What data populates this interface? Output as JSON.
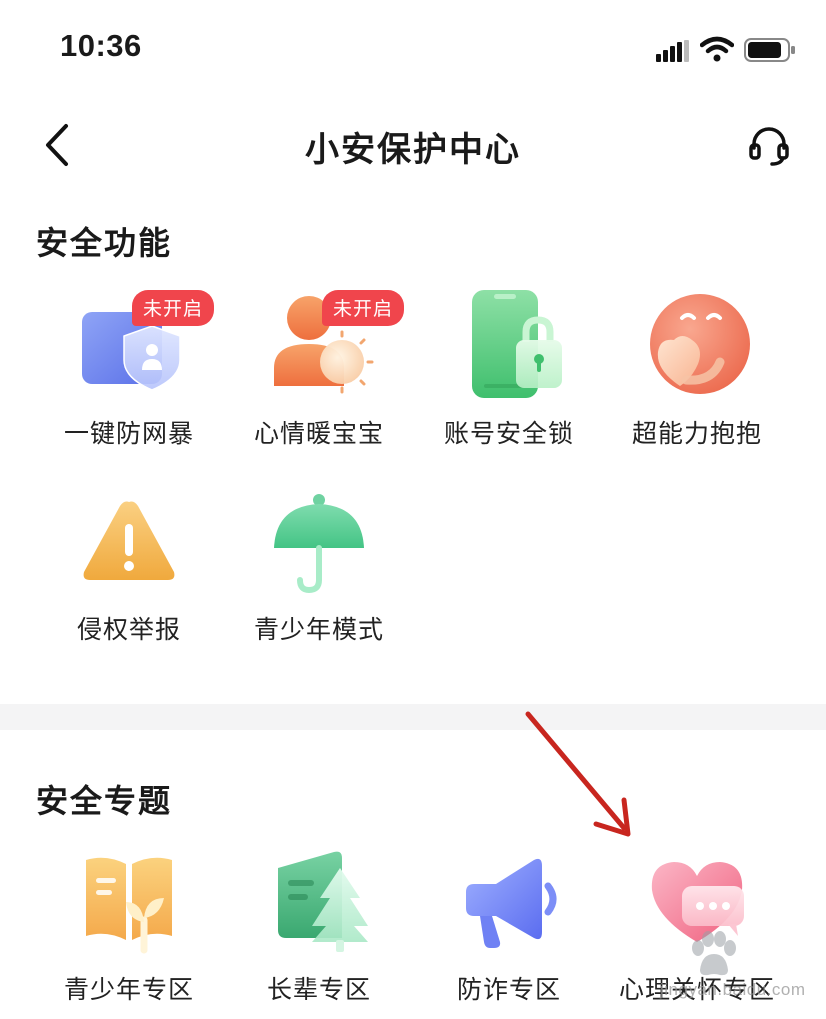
{
  "status_bar": {
    "time": "10:36",
    "icons": [
      "signal-icon",
      "wifi-icon",
      "battery-icon"
    ]
  },
  "nav": {
    "title": "小安保护中心",
    "back_icon": "chevron-left-icon",
    "service_icon": "headset-icon"
  },
  "safety_features": {
    "title": "安全功能",
    "items": [
      {
        "label": "一键防网暴",
        "icon": "shield-user-icon",
        "badge": "未开启"
      },
      {
        "label": "心情暖宝宝",
        "icon": "sun-person-icon",
        "badge": "未开启"
      },
      {
        "label": "账号安全锁",
        "icon": "phone-lock-icon",
        "badge": ""
      },
      {
        "label": "超能力抱抱",
        "icon": "hug-face-icon",
        "badge": ""
      },
      {
        "label": "侵权举报",
        "icon": "warning-icon",
        "badge": ""
      },
      {
        "label": "青少年模式",
        "icon": "umbrella-icon",
        "badge": ""
      }
    ]
  },
  "safety_topics": {
    "title": "安全专题",
    "items": [
      {
        "label": "青少年专区",
        "icon": "book-sprout-icon"
      },
      {
        "label": "长辈专区",
        "icon": "tree-card-icon"
      },
      {
        "label": "防诈专区",
        "icon": "megaphone-icon"
      },
      {
        "label": "心理关怀专区",
        "icon": "heart-chat-icon"
      }
    ]
  },
  "watermark": {
    "text": "jingyan.baidu.com"
  },
  "colors": {
    "badge": "#f0454c",
    "annotation_arrow": "#c8261f",
    "divider": "#f4f4f5"
  }
}
